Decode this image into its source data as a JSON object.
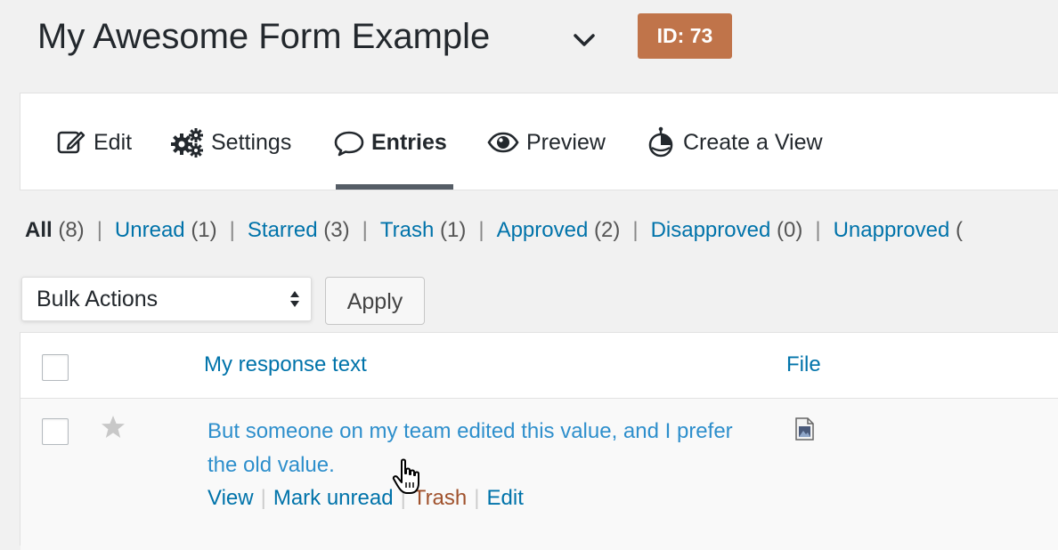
{
  "header": {
    "title": "My Awesome Form Example",
    "badge": "ID: 73"
  },
  "nav": {
    "edit": "Edit",
    "settings": "Settings",
    "entries": "Entries",
    "preview": "Preview",
    "create_view": "Create a View"
  },
  "filters": [
    {
      "label": "All",
      "count": "(8)"
    },
    {
      "label": "Unread",
      "count": "(1)"
    },
    {
      "label": "Starred",
      "count": "(3)"
    },
    {
      "label": "Trash",
      "count": "(1)"
    },
    {
      "label": "Approved",
      "count": "(2)"
    },
    {
      "label": "Disapproved",
      "count": "(0)"
    },
    {
      "label": "Unapproved",
      "count": "("
    }
  ],
  "bulk": {
    "select_value": "Bulk Actions",
    "apply_label": "Apply"
  },
  "table": {
    "columns": [
      "My response text",
      "File"
    ],
    "rows": [
      {
        "text": "But someone on my team edited this value, and I prefer the old value.",
        "actions": {
          "view": "View",
          "mark_unread": "Mark unread",
          "trash": "Trash",
          "edit": "Edit"
        }
      }
    ]
  },
  "colors": {
    "accent": "#0073aa",
    "badge": "#c0744a",
    "trash": "#a0522d"
  }
}
